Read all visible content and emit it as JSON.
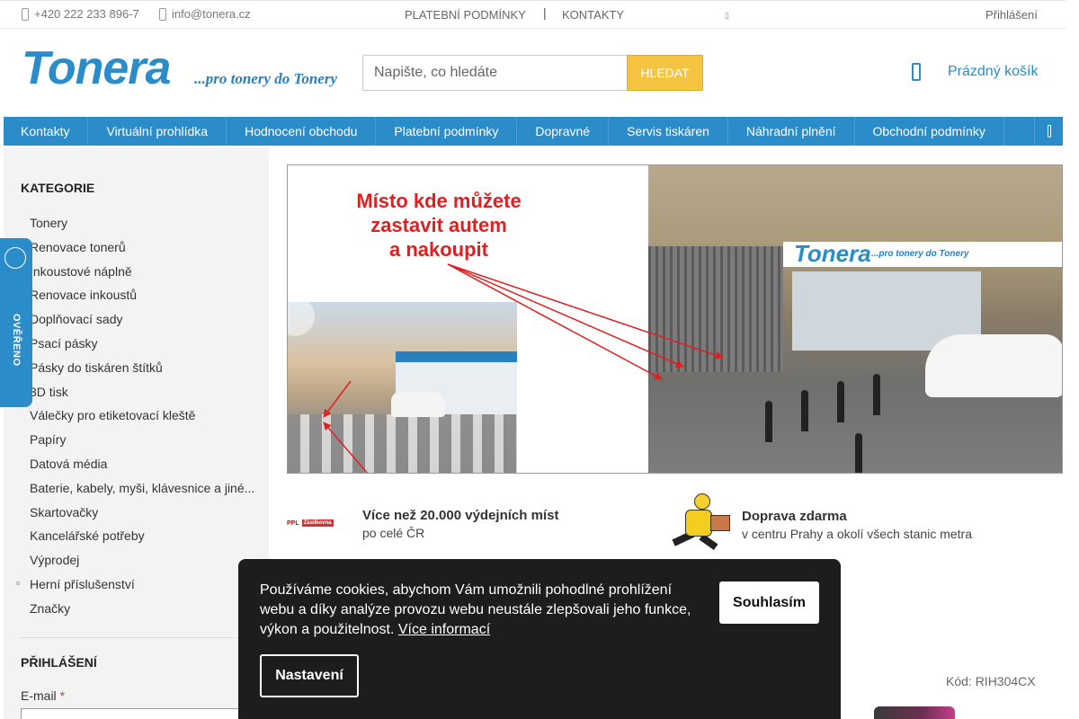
{
  "topbar": {
    "phone": "+420 222 233 896-7",
    "email": "info@tonera.cz",
    "links": [
      "PLATEBNÍ PODMÍNKY",
      "KONTAKTY"
    ],
    "login": "Přihlášení"
  },
  "header": {
    "logo_main": "Tonera",
    "logo_sub": "...pro tonery do Tonery",
    "search_placeholder": "Napište, co hledáte",
    "search_button": "HLEDAT",
    "cart_label": "Prázdný košík"
  },
  "nav": {
    "items": [
      "Kontakty",
      "Virtuální prohlídka",
      "Hodnocení obchodu",
      "Platební podmínky",
      "Dopravné",
      "Servis tiskáren",
      "Náhradní plnění",
      "Obchodní podmínky"
    ]
  },
  "sidebar": {
    "heading": "KATEGORIE",
    "categories": [
      "Tonery",
      "Renovace tonerů",
      "Inkoustové náplně",
      "Renovace inkoustů",
      "Doplňovací sady",
      "Psací pásky",
      "Pásky do tiskáren štítků",
      "3D tisk",
      "Válečky pro etiketovací kleště",
      "Papíry",
      "Datová média",
      "Baterie, kabely, myši, klávesnice a jiné...",
      "Skartovačky",
      "Kancelářské potřeby",
      "Výprodej",
      "Herní příslušenství",
      "Značky"
    ],
    "login_heading": "PŘIHLÁŠENÍ",
    "email_label": "E-mail",
    "required_mark": "*"
  },
  "badge": {
    "text": "OVĚŘENO ZÁKAZNÍKY"
  },
  "banner": {
    "caption_lines": [
      "Místo kde můžete",
      "zastavit autem",
      "a nakoupit"
    ],
    "shop_sign": "Tonera",
    "shop_sign_sub": "...pro tonery do Tonery"
  },
  "info": {
    "pickup_logos": [
      "PPL",
      "Zásilkovna"
    ],
    "pickup_title": "Více než 20.000 výdejních míst",
    "pickup_sub": "po celé ČR",
    "delivery_title": "Doprava zdarma",
    "delivery_sub": "v centru Prahy a okolí všech stanic metra"
  },
  "product": {
    "code": "Kód: RIH304CX"
  },
  "cookie": {
    "message": "Používáme cookies, abychom Vám umožnili pohodlné prohlížení webu a díky analýze provozu webu neustále zlepšovali jeho funkce, výkon a použitelnost.",
    "more_link": "Více informací",
    "agree_button": "Souhlasím",
    "settings_button": "Nastavení"
  },
  "colors": {
    "brand_blue": "#2a8cc9",
    "search_button": "#f5c542",
    "caption_red": "#e02020",
    "cookie_bg": "#1d1d1d"
  }
}
